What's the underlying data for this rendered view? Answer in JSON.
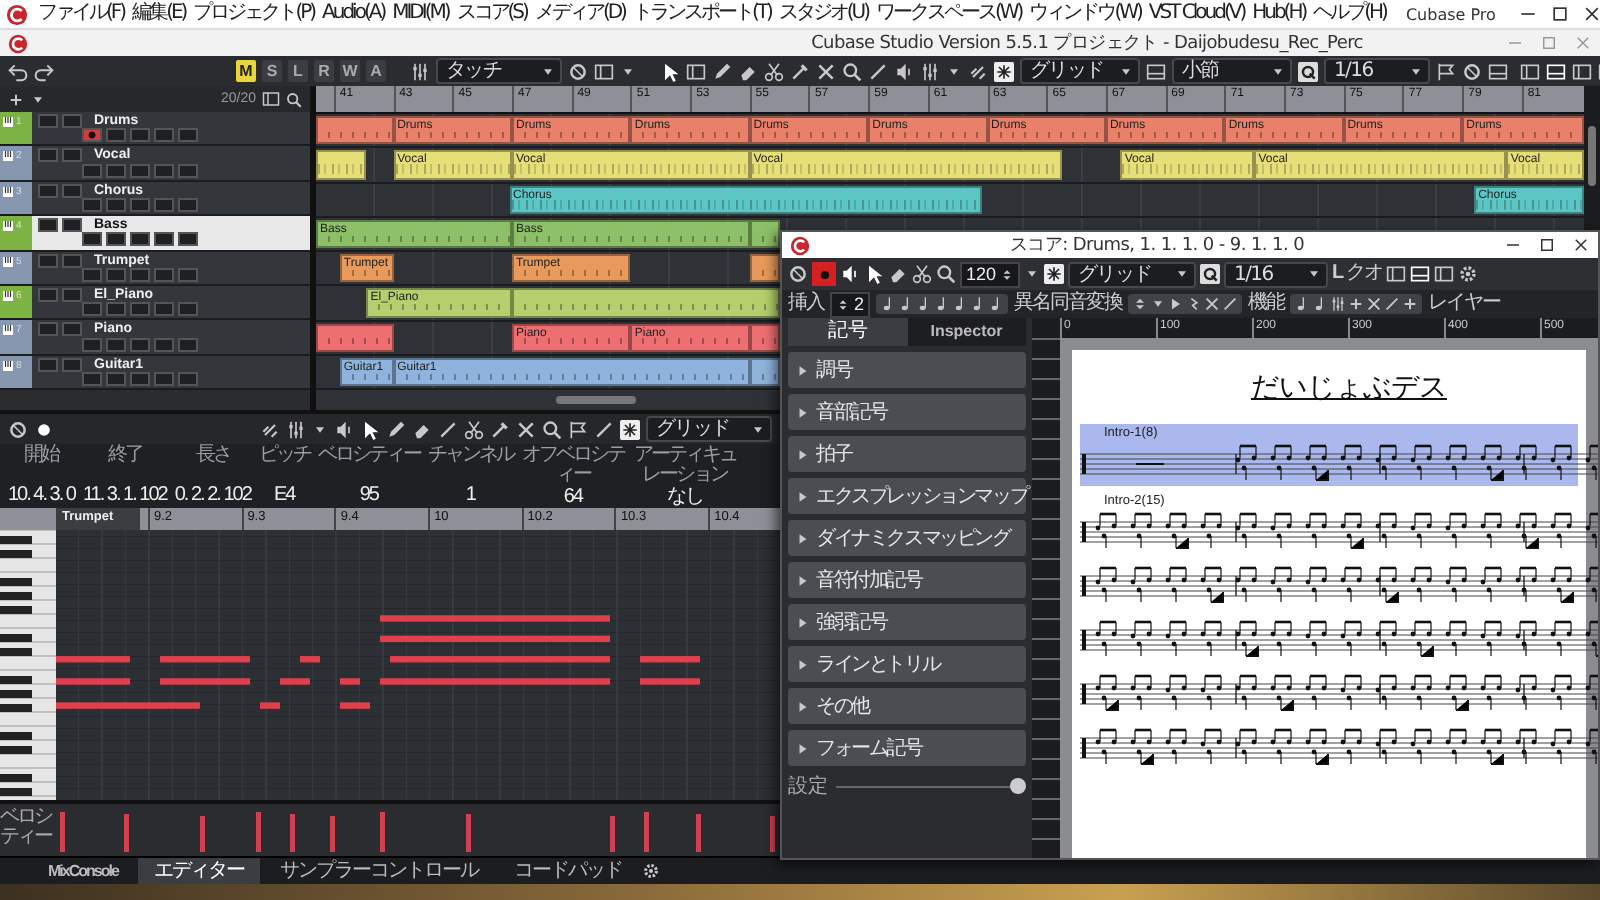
{
  "menubar": {
    "menus": [
      "ファイル(F)",
      "編集(E)",
      "プロジェクト(P)",
      "Audio(A)",
      "MIDI(M)",
      "スコア(S)",
      "メディア(D)",
      "トランスポート(T)",
      "スタジオ(U)",
      "ワークスペース(W)",
      "ウィンドウ(W)",
      "VST Cloud(V)",
      "Hub(H)",
      "ヘルプ(H)"
    ],
    "app_title": "Cubase Pro"
  },
  "project_window": {
    "title": "Cubase Studio Version 5.5.1 プロジェクト - Daijobudesu_Rec_Perc",
    "toolbar": {
      "modes": [
        {
          "label": "M",
          "selected": true
        },
        {
          "label": "S",
          "selected": false
        },
        {
          "label": "L",
          "selected": false
        },
        {
          "label": "R",
          "selected": false
        },
        {
          "label": "W",
          "selected": false
        },
        {
          "label": "A",
          "selected": false
        }
      ],
      "automation_mode": "タッチ",
      "snap_type": "グリッド",
      "grid_type": "小節",
      "quantize": "1/16"
    },
    "track_count": "20/20",
    "ruler": [
      "41",
      "43",
      "45",
      "47",
      "49",
      "51",
      "53",
      "55",
      "57",
      "59",
      "61",
      "63",
      "65",
      "67",
      "69",
      "71",
      "73",
      "75",
      "77",
      "79",
      "81"
    ],
    "tracks": [
      {
        "number": "1",
        "name": "Drums",
        "kind": "instrument",
        "color": "#e8806a",
        "selected": false,
        "record_enabled": true,
        "events": [
          {
            "kind": "midi"
          },
          {
            "kind": "midi",
            "name": "Drums"
          },
          {
            "kind": "midi",
            "name": "Drums"
          },
          {
            "kind": "midi",
            "name": "Drums"
          },
          {
            "kind": "midi",
            "name": "Drums"
          },
          {
            "kind": "midi",
            "name": "Drums"
          },
          {
            "kind": "midi",
            "name": "Drums"
          },
          {
            "kind": "midi",
            "name": "Drums"
          },
          {
            "kind": "midi",
            "name": "Drums"
          },
          {
            "kind": "midi",
            "name": "Drums"
          },
          {
            "kind": "midi",
            "name": "Drums"
          }
        ]
      },
      {
        "number": "2",
        "name": "Vocal",
        "kind": "midi",
        "color": "#e6df78",
        "selected": false,
        "record_enabled": false,
        "events": [
          {
            "kind": "audio"
          },
          {
            "kind": "audio",
            "name": "Vocal"
          },
          {
            "kind": "audio",
            "name": "Vocal"
          },
          {
            "kind": "audio",
            "name": "Vocal"
          },
          {
            "kind": "audio",
            "name": "Vocal"
          },
          {
            "kind": "audio",
            "name": "Vocal"
          },
          {
            "kind": "audio",
            "name": "Vocal"
          }
        ]
      },
      {
        "number": "3",
        "name": "Chorus",
        "kind": "midi",
        "color": "#5cc6c4",
        "selected": false,
        "record_enabled": false,
        "events": [
          {
            "kind": "audio",
            "name": "Chorus"
          },
          {
            "kind": "audio",
            "name": "Chorus"
          }
        ]
      },
      {
        "number": "4",
        "name": "Bass",
        "kind": "instrument",
        "color": "#8dbf68",
        "selected": true,
        "record_enabled": false,
        "events": [
          {
            "kind": "midi",
            "name": "Bass"
          },
          {
            "kind": "midi",
            "name": "Bass"
          },
          {
            "kind": "midi"
          }
        ]
      },
      {
        "number": "5",
        "name": "Trumpet",
        "kind": "midi",
        "color": "#e89a5c",
        "selected": false,
        "record_enabled": false,
        "events": [
          {
            "kind": "midi",
            "name": "Trumpet"
          },
          {
            "kind": "midi",
            "name": "Trumpet"
          },
          {
            "kind": "midi"
          }
        ]
      },
      {
        "number": "6",
        "name": "El_Piano",
        "kind": "instrument",
        "color": "#b5cf6e",
        "selected": false,
        "record_enabled": false,
        "events": [
          {
            "kind": "midi",
            "name": "El_Piano"
          },
          {
            "kind": "midi"
          }
        ]
      },
      {
        "number": "7",
        "name": "Piano",
        "kind": "midi",
        "color": "#ee6f72",
        "selected": false,
        "record_enabled": false,
        "events": [
          {
            "kind": "midi"
          },
          {
            "kind": "midi",
            "name": "Piano"
          },
          {
            "kind": "midi",
            "name": "Piano"
          },
          {
            "kind": "midi"
          }
        ]
      },
      {
        "number": "8",
        "name": "Guitar1",
        "kind": "midi",
        "color": "#8fb3dc",
        "selected": false,
        "record_enabled": false,
        "events": [
          {
            "kind": "midi",
            "name": "Guitar1"
          },
          {
            "kind": "midi",
            "name": "Guitar1"
          },
          {
            "kind": "midi"
          }
        ]
      }
    ]
  },
  "key_editor": {
    "snap_type": "グリッド",
    "info": [
      {
        "label": "開始",
        "value": "10. 4. 3. 0"
      },
      {
        "label": "終了",
        "value": "11. 3. 1. 102"
      },
      {
        "label": "長さ",
        "value": "0. 2. 2. 102"
      },
      {
        "label": "ピッチ",
        "value": "E4"
      },
      {
        "label": "ベロシティー",
        "value": "95"
      },
      {
        "label": "チャンネル",
        "value": "1"
      },
      {
        "label": "オフベロシティー",
        "value": "64"
      },
      {
        "label": "アーティキュレーション",
        "value": "なし"
      }
    ],
    "part_name": "Trumpet",
    "ruler": [
      "9.2",
      "9.3",
      "9.4",
      "10",
      "10.2",
      "10.3",
      "10.4"
    ],
    "velocity_label": "ベロシティー"
  },
  "score_window": {
    "title": "スコア: Drums, 1. 1. 1. 0 - 9. 1. 1. 0",
    "tempo": "120",
    "snap_type": "グリッド",
    "quantize": "1/16",
    "label_1": "L",
    "label_2": "クオ",
    "insert_label": "挿入",
    "insert_value": "2",
    "enharmonic_label": "異名同音変換",
    "function_label": "機能",
    "layer_label": "レイヤー",
    "tabs": [
      {
        "label": "記号",
        "selected": true
      },
      {
        "label": "Inspector",
        "selected": false
      }
    ],
    "sections": [
      "調号",
      "音部記号",
      "拍子",
      "エクスプレッションマップ",
      "ダイナミクスマッピング",
      "音符付加記号",
      "強弱記号",
      "ラインとトリル",
      "その他",
      "フォーム記号"
    ],
    "settings": {
      "label": "設定",
      "level": 1
    },
    "ruler": [
      "0",
      "100",
      "200",
      "300",
      "400",
      "500"
    ],
    "page": {
      "title": "だいじょぶデス",
      "staves": [
        {
          "label": "Intro-1(8)",
          "selected": true
        },
        {
          "label": "Intro-2(15)",
          "selected": false
        },
        {
          "selected": false
        },
        {
          "selected": false
        },
        {
          "selected": false
        },
        {
          "selected": false
        }
      ]
    }
  },
  "bottom_tabs": [
    {
      "label": "MixConsole",
      "selected": false
    },
    {
      "label": "エディター",
      "selected": true
    },
    {
      "label": "サンプラーコントロール",
      "selected": false
    },
    {
      "label": "コードパッド",
      "selected": false
    }
  ]
}
